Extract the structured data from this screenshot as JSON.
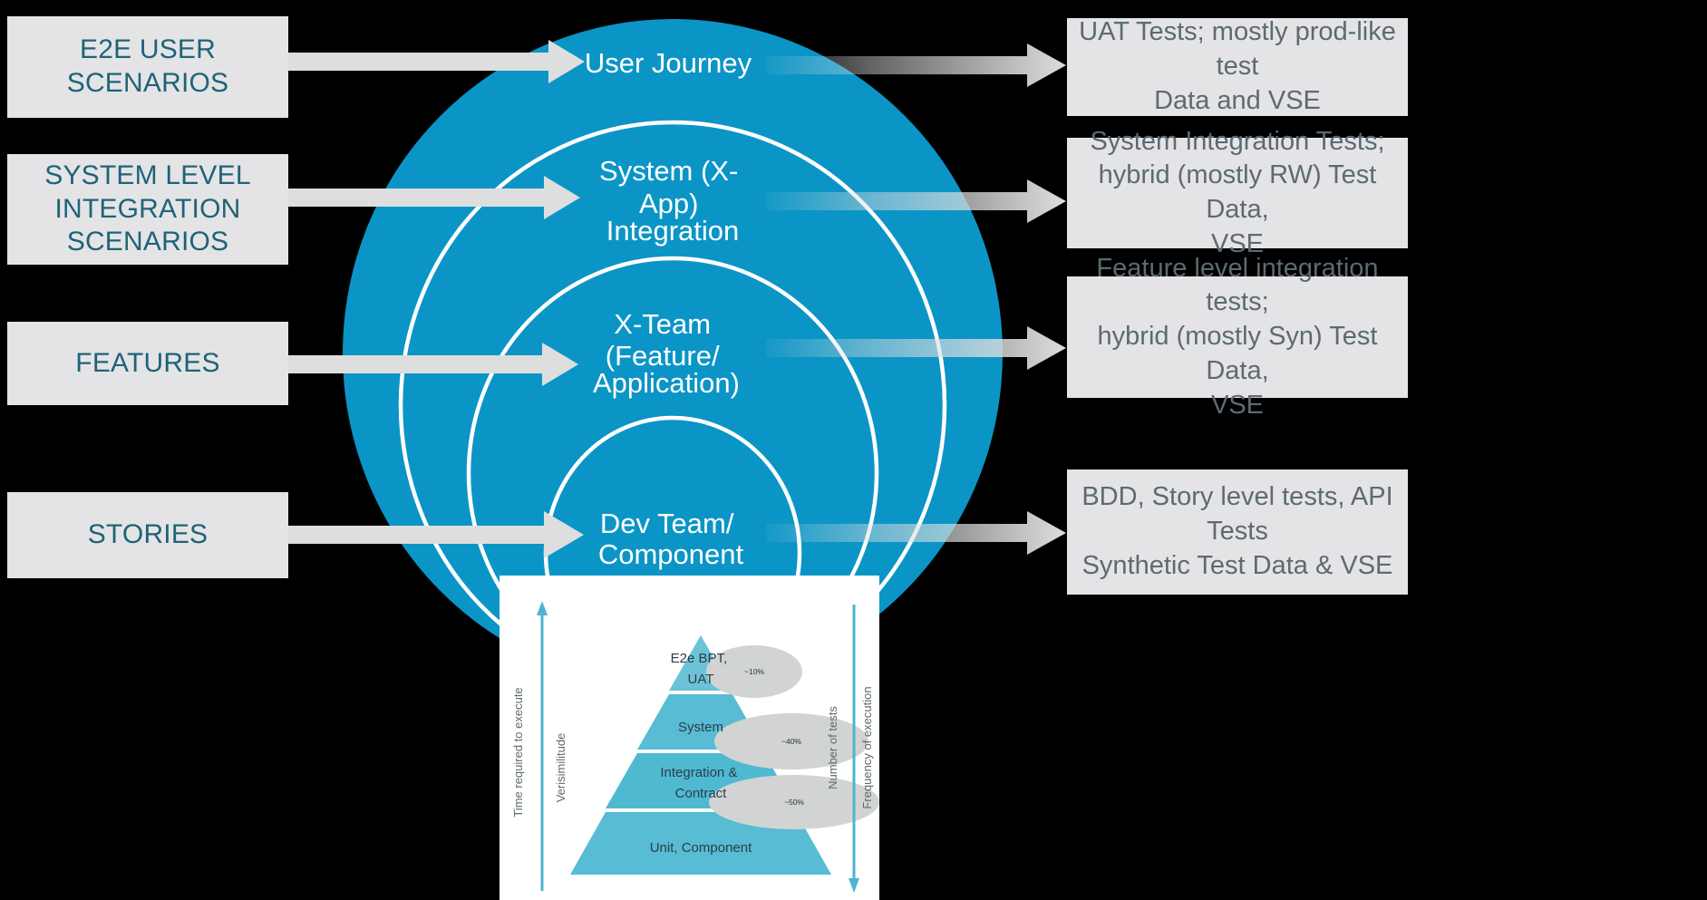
{
  "colors": {
    "background": "#000000",
    "circle_blue": "#0b95c6",
    "box_fill": "#e4e4e6",
    "left_text": "#1f6377",
    "right_text": "#5d6a71",
    "arrow_gray": "#dedede",
    "ring_stroke": "#ffffff",
    "pyramid_blue": "#57bcd4",
    "pyramid_oval": "#d2d4d4",
    "pyramid_axis": "#4fb4cf",
    "pyramid_text": "#2d3c47"
  },
  "left_boxes": [
    {
      "label": "E2E USER SCENARIOS"
    },
    {
      "label": "SYSTEM LEVEL\nINTEGRATION\nSCENARIOS"
    },
    {
      "label": "FEATURES"
    },
    {
      "label": "STORIES"
    }
  ],
  "rings": [
    {
      "label_lines": [
        "User Journey"
      ]
    },
    {
      "label_lines": [
        "System (X-",
        "App)",
        "Integration"
      ]
    },
    {
      "label_lines": [
        "X-Team",
        "(Feature/",
        "Application)"
      ]
    },
    {
      "label_lines": [
        "Dev Team/",
        "Component"
      ]
    }
  ],
  "right_boxes": [
    {
      "label": "UAT Tests; mostly prod-like test\nData and VSE"
    },
    {
      "label": "System Integration Tests;\nhybrid (mostly RW) Test Data,\nVSE"
    },
    {
      "label": "Feature  level integration tests;\nhybrid (mostly Syn) Test Data,\nVSE"
    },
    {
      "label": "BDD, Story level tests, API\nTests\nSynthetic Test Data &  VSE"
    }
  ],
  "pyramid": {
    "left_axis_labels": [
      "Time required to execute",
      "Verisimilitude"
    ],
    "right_axis_labels": [
      "Number of tests",
      "Frequency of execution"
    ],
    "tiers": [
      {
        "lines": [
          "E2e BPT,",
          "UAT"
        ]
      },
      {
        "lines": [
          "System"
        ]
      },
      {
        "lines": [
          "Integration &",
          "Contract"
        ]
      },
      {
        "lines": [
          "Unit, Component"
        ]
      }
    ],
    "percentages": [
      "~10%",
      "~40%",
      "~50%"
    ]
  }
}
